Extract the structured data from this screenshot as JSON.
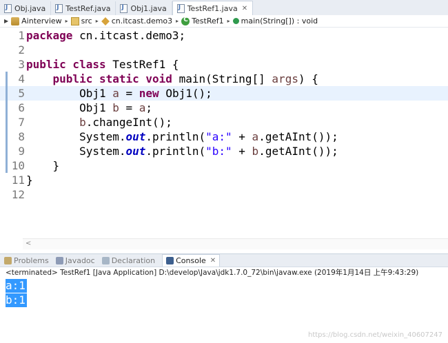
{
  "tabs": [
    {
      "label": "Obj.java",
      "active": false
    },
    {
      "label": "TestRef.java",
      "active": false
    },
    {
      "label": "Obj1.java",
      "active": false
    },
    {
      "label": "TestRef1.java",
      "active": true,
      "close": "✕"
    }
  ],
  "breadcrumb": {
    "items": [
      "Ainterview",
      "src",
      "cn.itcast.demo3",
      "TestRef1",
      "main(String[]) : void"
    ],
    "separator": "▸"
  },
  "editor": {
    "current_line": 5,
    "line_numbers": [
      "1",
      "2",
      "3",
      "4",
      "5",
      "6",
      "7",
      "8",
      "9",
      "10",
      "11",
      "12"
    ],
    "lines": [
      [
        {
          "t": "package ",
          "c": "kw"
        },
        {
          "t": "cn.itcast.demo3;",
          "c": ""
        }
      ],
      [],
      [
        {
          "t": "public class ",
          "c": "kw"
        },
        {
          "t": "TestRef1 {",
          "c": ""
        }
      ],
      [
        {
          "t": "    ",
          "c": ""
        },
        {
          "t": "public static void ",
          "c": "kw"
        },
        {
          "t": "main(String[] ",
          "c": ""
        },
        {
          "t": "args",
          "c": "var"
        },
        {
          "t": ") {",
          "c": ""
        }
      ],
      [
        {
          "t": "        Obj1 ",
          "c": ""
        },
        {
          "t": "a",
          "c": "var"
        },
        {
          "t": " = ",
          "c": ""
        },
        {
          "t": "new ",
          "c": "kw"
        },
        {
          "t": "Obj1();",
          "c": ""
        }
      ],
      [
        {
          "t": "        Obj1 ",
          "c": ""
        },
        {
          "t": "b",
          "c": "var"
        },
        {
          "t": " = ",
          "c": ""
        },
        {
          "t": "a",
          "c": "var"
        },
        {
          "t": ";",
          "c": ""
        }
      ],
      [
        {
          "t": "        ",
          "c": ""
        },
        {
          "t": "b",
          "c": "var"
        },
        {
          "t": ".changeInt();",
          "c": ""
        }
      ],
      [
        {
          "t": "        System.",
          "c": ""
        },
        {
          "t": "out",
          "c": "fld"
        },
        {
          "t": ".println(",
          "c": ""
        },
        {
          "t": "\"a:\"",
          "c": "str"
        },
        {
          "t": " + ",
          "c": ""
        },
        {
          "t": "a",
          "c": "var"
        },
        {
          "t": ".getAInt());",
          "c": ""
        }
      ],
      [
        {
          "t": "        System.",
          "c": ""
        },
        {
          "t": "out",
          "c": "fld"
        },
        {
          "t": ".println(",
          "c": ""
        },
        {
          "t": "\"b:\"",
          "c": "str"
        },
        {
          "t": " + ",
          "c": ""
        },
        {
          "t": "b",
          "c": "var"
        },
        {
          "t": ".getAInt());",
          "c": ""
        }
      ],
      [
        {
          "t": "    }",
          "c": ""
        }
      ],
      [
        {
          "t": "}",
          "c": ""
        }
      ],
      []
    ]
  },
  "views": {
    "tabs": [
      {
        "label": "Problems",
        "icon": "problems-icon",
        "active": false
      },
      {
        "label": "Javadoc",
        "icon": "javadoc-icon",
        "active": false
      },
      {
        "label": "Declaration",
        "icon": "declaration-icon",
        "active": false
      },
      {
        "label": "Console",
        "icon": "console-icon",
        "active": true,
        "close": "✕"
      }
    ]
  },
  "console": {
    "terminated": "<terminated> TestRef1 [Java Application] D:\\develop\\Java\\jdk1.7.0_72\\bin\\javaw.exe (2019年1月14日 上午9:43:29)",
    "output": [
      "a:1",
      "b:1"
    ]
  },
  "watermark": "https://blog.csdn.net/weixin_40607247",
  "colors": {
    "keyword": "#7f0055",
    "string": "#2a00ff",
    "field": "#0000c0",
    "selection": "#3399ff",
    "current_line": "#e8f2fe"
  }
}
